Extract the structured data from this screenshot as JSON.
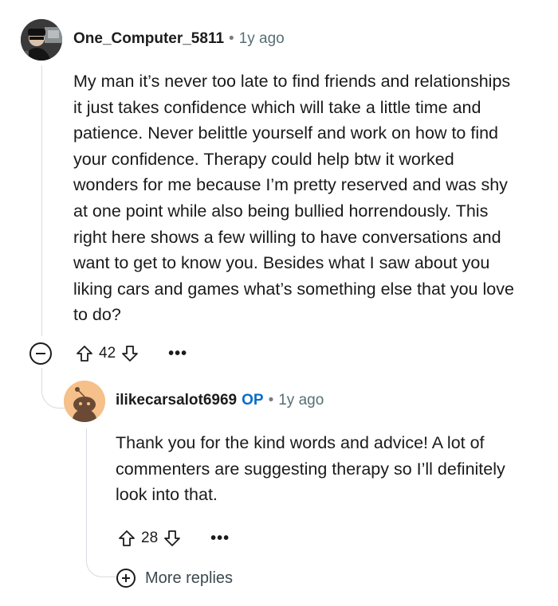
{
  "comment": {
    "username": "One_Computer_5811",
    "separator": "•",
    "time": "1y ago",
    "text": "My man it’s never too late to find friends and relationships it just takes confidence which will take a little time and patience. Never belittle yourself and work on how to find your confidence. Therapy could help btw it worked wonders for me because I’m pretty reserved and was shy at one point while also being bullied horrendously. This right here shows a few willing to have conversations and want to get to know you. Besides what I saw about you liking cars and games what’s something else that you love to do?",
    "votes": "42",
    "more": "•••",
    "icons": [
      "avatar",
      "collapse-icon",
      "upvote-icon",
      "downvote-icon",
      "more-options-icon"
    ]
  },
  "reply": {
    "username": "ilikecarsalot6969",
    "op_badge": "OP",
    "separator": "•",
    "time": "1y ago",
    "text": "Thank you for the kind words and advice! A lot of commenters are suggesting therapy so I’ll definitely look into that.",
    "votes": "28",
    "more": "•••",
    "icons": [
      "snoo-avatar",
      "upvote-icon",
      "downvote-icon",
      "more-options-icon"
    ]
  },
  "more_replies": {
    "label": "More replies",
    "icon": "plus-circle-icon"
  },
  "colors": {
    "op_blue": "#0b6cc9",
    "thread_line": "#d6dbe0",
    "meta_gray": "#576f76"
  }
}
